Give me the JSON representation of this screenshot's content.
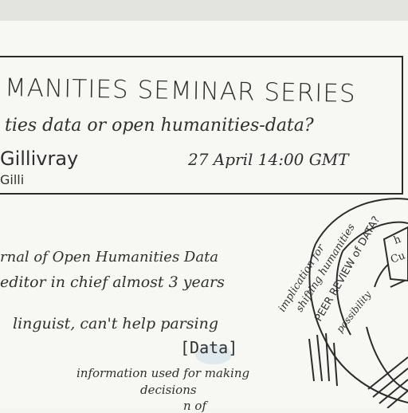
{
  "title_box": {
    "series_title": "MANITIES SEMINAR SERIES",
    "talk_title": "ties data or open humanities-data?",
    "speaker": "Gillivray",
    "datetime": "27 April 14:00 GMT",
    "handle": "Gilli"
  },
  "notes": {
    "line1": "rnal of Open Humanities Data",
    "line2": "editor in chief almost 3 years",
    "line3": "linguist, can't help parsing",
    "bracket_word": "[Data]",
    "line4": "information used for making",
    "line5": "decisions",
    "line6": "n of"
  },
  "diagram": {
    "arc_label1": "implication for",
    "arc_label2": "shifting humanities",
    "arc_label3": "PEER REVIEW of DATA?",
    "arc_label4": "possibility",
    "card_text1": "h",
    "card_text2": "Cu"
  }
}
